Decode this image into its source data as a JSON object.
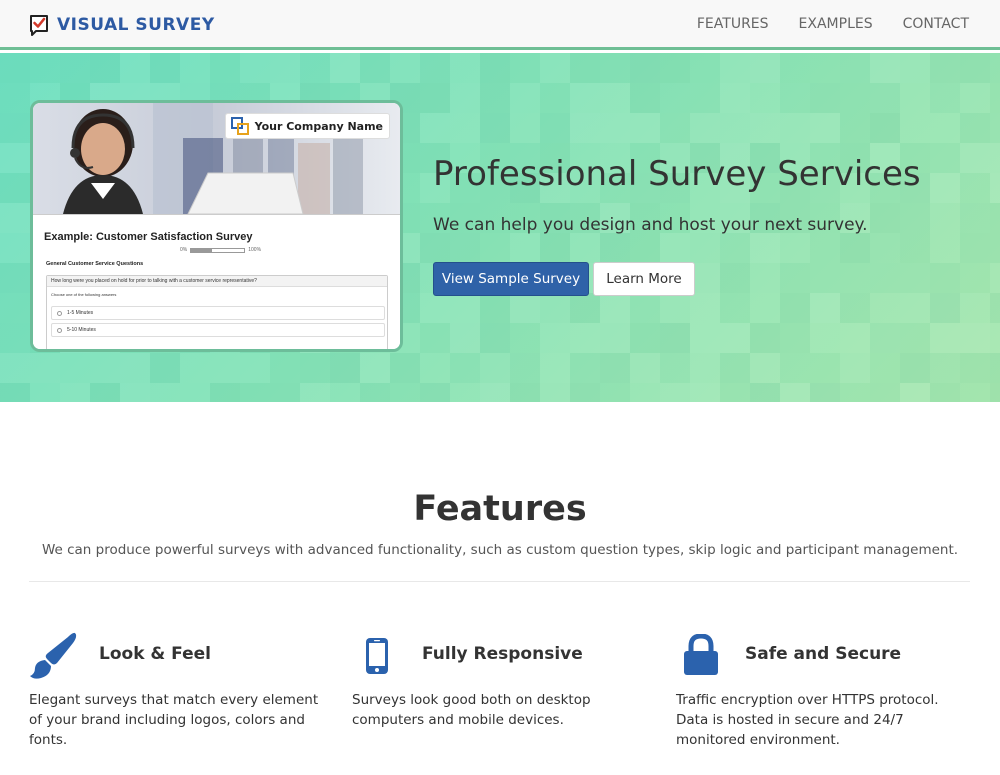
{
  "navbar": {
    "brand": "VISUAL SURVEY",
    "links": [
      "FEATURES",
      "EXAMPLES",
      "CONTACT"
    ]
  },
  "hero": {
    "title": "Professional Survey Services",
    "subtitle": "We can help you design and host your next survey.",
    "primary_button": "View Sample Survey",
    "secondary_button": "Learn More",
    "preview": {
      "company_name": "Your Company Name",
      "survey_title": "Example: Customer Satisfaction Survey",
      "progress_start": "0%",
      "progress_end": "100%",
      "progress_fraction": 0.4,
      "section_title": "General Customer Service Questions",
      "question": "How long were you placed on hold for prior to talking with a customer service representative?",
      "instruction": "Choose one of the following answers",
      "options": [
        "1-5 Minutes",
        "5-10 Minutes"
      ]
    }
  },
  "features": {
    "title": "Features",
    "subtitle": "We can produce powerful surveys with advanced functionality, such as custom question types, skip logic and participant management.",
    "items": [
      {
        "icon": "paintbrush-icon",
        "heading": "Look & Feel",
        "text": "Elegant surveys that match every element of your brand including logos, colors and fonts."
      },
      {
        "icon": "mobile-phone-icon",
        "heading": "Fully Responsive",
        "text": "Surveys look good both on desktop computers and mobile devices."
      },
      {
        "icon": "lock-icon",
        "heading": "Safe and Secure",
        "text": "Traffic encryption over HTTPS protocol. Data is hosted in secure and 24/7 monitored environment."
      }
    ]
  },
  "colors": {
    "brand_blue": "#2d5aa3",
    "primary_button": "#2f62a8",
    "icon_blue": "#2b62ad",
    "hero_green": "#86e3b8",
    "checkmark_red": "#d33a2c"
  }
}
